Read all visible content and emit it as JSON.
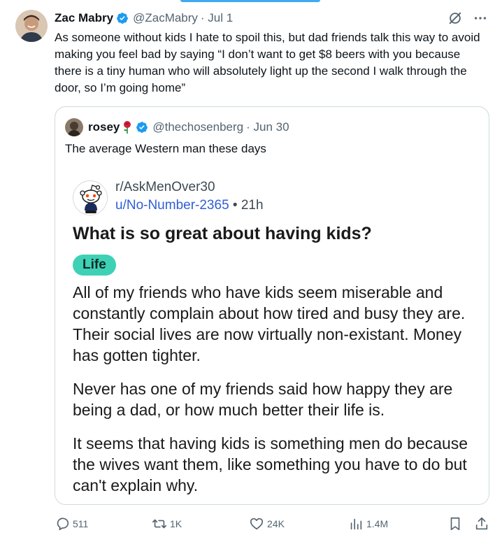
{
  "tweet": {
    "author_name": "Zac Mabry",
    "author_handle": "@ZacMabry",
    "date": "· Jul 1",
    "text": "As someone without kids I hate to spoil this, but dad friends talk this way to avoid making you feel bad by saying “I don’t want to get $8 beers with you because there is a tiny human who will absolutely light up the second I walk through the door, so I’m going home”"
  },
  "quote": {
    "author_name": "rosey",
    "author_handle": "@thechosenberg",
    "date": "· Jun 30",
    "text": "The average Western man these days"
  },
  "reddit": {
    "subreddit": "r/AskMenOver30",
    "username": "u/No-Number-2365",
    "time": " • 21h",
    "title": "What is so great about having kids?",
    "flair": "Life",
    "paragraphs": [
      "All of my friends who have kids seem miserable and constantly complain about how tired and busy they are. Their social lives are now virtually non-existant. Money has gotten tighter.",
      "Never has one of my friends said how happy they are being a dad, or how much better their life is.",
      "It seems that having kids is something men do because the wives want them, like something you have to do but can't explain why."
    ]
  },
  "actions": {
    "replies": "511",
    "reposts": "1K",
    "likes": "24K",
    "views": "1.4M"
  },
  "colors": {
    "verified": "#1d9bf0",
    "flair": "#3fd1b5",
    "reddit_link": "#2f5fd4"
  }
}
